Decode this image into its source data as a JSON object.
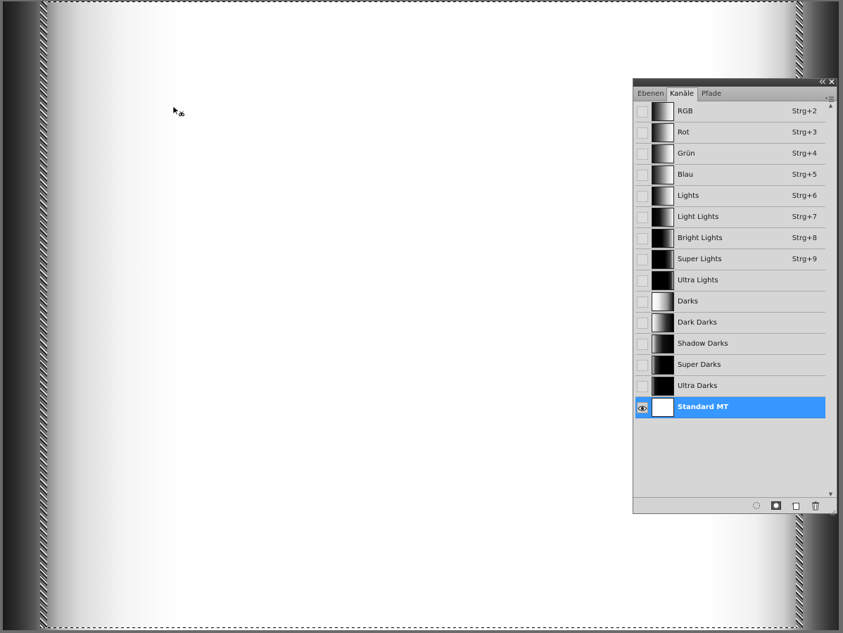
{
  "tabs": [
    {
      "label": "Ebenen",
      "active": false
    },
    {
      "label": "Kanäle",
      "active": true
    },
    {
      "label": "Pfade",
      "active": false
    }
  ],
  "channels": [
    {
      "name": "RGB",
      "shortcut": "Strg+2",
      "thumb": "linear-gradient(to right, #111 0%, #666 35%, #ddd 75%, #fff 100%)"
    },
    {
      "name": "Rot",
      "shortcut": "Strg+3",
      "thumb": "linear-gradient(to right, #111 0%, #666 35%, #ddd 75%, #fff 100%)"
    },
    {
      "name": "Grün",
      "shortcut": "Strg+4",
      "thumb": "linear-gradient(to right, #111 0%, #666 35%, #ddd 75%, #fff 100%)"
    },
    {
      "name": "Blau",
      "shortcut": "Strg+5",
      "thumb": "linear-gradient(to right, #111 0%, #666 35%, #ddd 75%, #fff 100%)"
    },
    {
      "name": "Lights",
      "shortcut": "Strg+6",
      "thumb": "linear-gradient(to right, #000 0%, #444 30%, #ccc 70%, #fff 100%)"
    },
    {
      "name": "Light Lights",
      "shortcut": "Strg+7",
      "thumb": "linear-gradient(to right, #000 0%, #111 35%, #888 70%, #fff 100%)"
    },
    {
      "name": "Bright Lights",
      "shortcut": "Strg+8",
      "thumb": "linear-gradient(to right, #000 0%, #000 45%, #555 75%, #eee 100%)"
    },
    {
      "name": "Super Lights",
      "shortcut": "Strg+9",
      "thumb": "linear-gradient(to right, #000 0%, #000 60%, #444 85%, #ddd 100%)"
    },
    {
      "name": "Ultra Lights",
      "shortcut": "",
      "thumb": "linear-gradient(to right, #000 0%, #000 75%, #333 90%, #bbb 100%)"
    },
    {
      "name": "Darks",
      "shortcut": "",
      "thumb": "linear-gradient(to right, #fff 0%, #eee 30%, #999 70%, #111 100%)"
    },
    {
      "name": "Dark Darks",
      "shortcut": "",
      "thumb": "linear-gradient(to right, #fff 0%, #bbb 25%, #333 65%, #000 100%)"
    },
    {
      "name": "Shadow Darks",
      "shortcut": "",
      "thumb": "linear-gradient(to right, #eee 0%, #666 20%, #111 50%, #000 100%)"
    },
    {
      "name": "Super Darks",
      "shortcut": "",
      "thumb": "linear-gradient(to right, #ccc 0%, #333 15%, #000 40%, #000 100%)"
    },
    {
      "name": "Ultra Darks",
      "shortcut": "",
      "thumb": "linear-gradient(to right, #999 0%, #111 12%, #000 30%, #000 100%)"
    },
    {
      "name": "Standard MT",
      "shortcut": "",
      "thumb": "linear-gradient(#ffffff, #ffffff)",
      "selected": true,
      "visible": true
    }
  ],
  "icons": {
    "panel_collapse": "double-chevron-left-icon",
    "panel_close": "close-icon",
    "panel_menu": "panel-menu-icon",
    "eye": "eye-icon",
    "footer": [
      "load-channel-as-selection-icon",
      "save-selection-as-channel-icon",
      "new-channel-icon",
      "trash-icon"
    ]
  },
  "colors": {
    "selection": "#3597ff",
    "panel_bg": "#d6d6d6",
    "titlebar": "#404040"
  }
}
